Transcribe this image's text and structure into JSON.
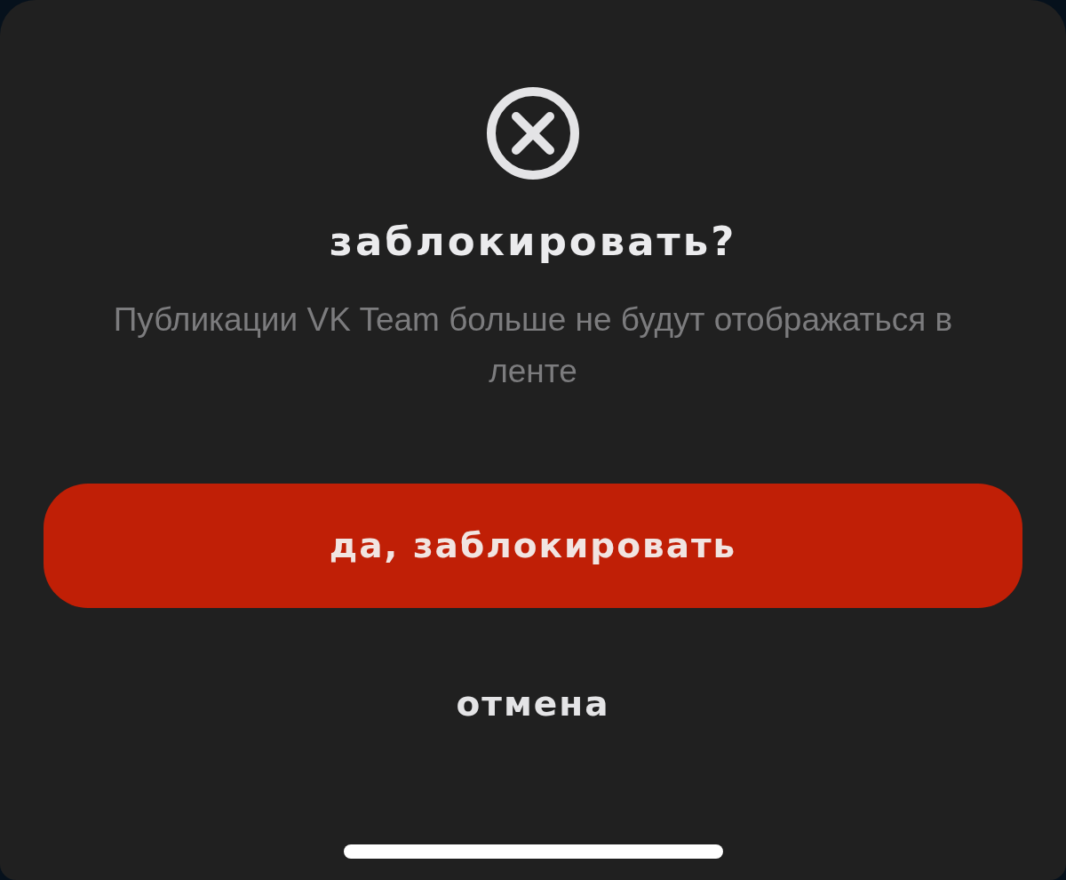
{
  "dialog": {
    "title": "заблокировать?",
    "message": "Публикации VK Team больше не будут отображаться в ленте",
    "buttons": [
      {
        "label": "да, заблокировать",
        "kind": "primary"
      },
      {
        "label": "отмена",
        "kind": "secondary"
      }
    ]
  }
}
